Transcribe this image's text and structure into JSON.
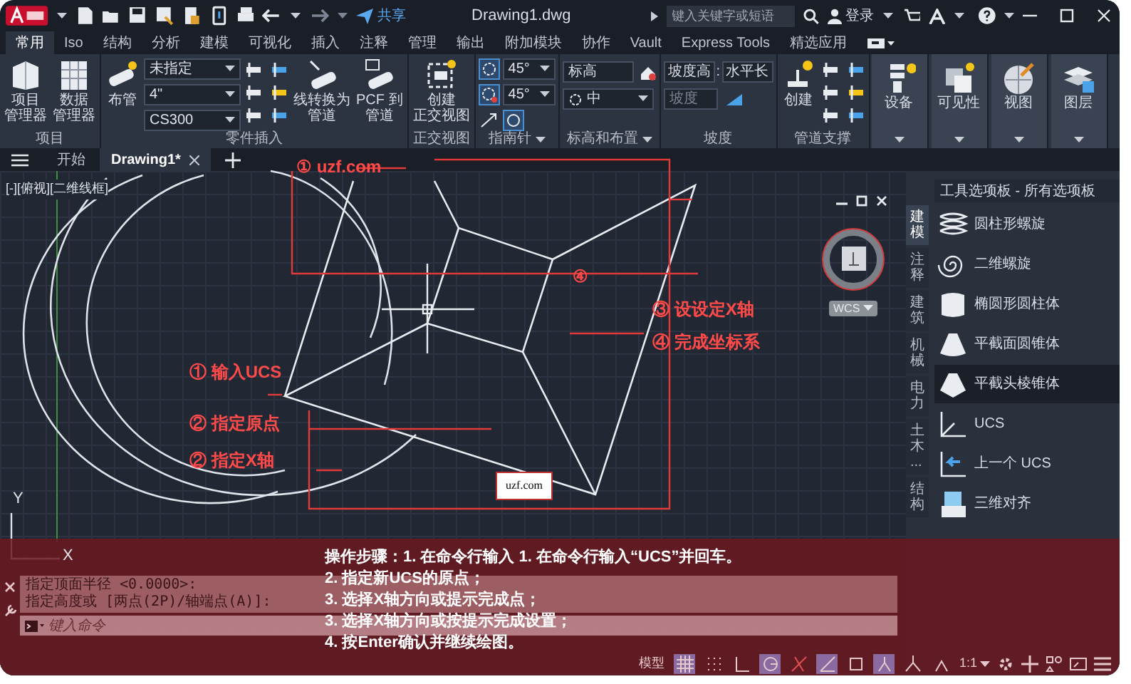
{
  "title_bar": {
    "share": "共享",
    "title": "Drawing1.dwg",
    "search": {
      "placeholder": "键入关键字或短语"
    },
    "login": "登录"
  },
  "ribbon_tabs": [
    {
      "label": "常用",
      "selected": true
    },
    {
      "label": "Iso",
      "selected": false
    },
    {
      "label": "结构",
      "selected": false
    },
    {
      "label": "分析",
      "selected": false
    },
    {
      "label": "建模",
      "selected": false
    },
    {
      "label": "可视化",
      "selected": false
    },
    {
      "label": "插入",
      "selected": false
    },
    {
      "label": "注释",
      "selected": false
    },
    {
      "label": "管理",
      "selected": false
    },
    {
      "label": "输出",
      "selected": false
    },
    {
      "label": "附加模块",
      "selected": false
    },
    {
      "label": "协作",
      "selected": false
    },
    {
      "label": "Vault",
      "selected": false
    },
    {
      "label": "Express Tools",
      "selected": false
    },
    {
      "label": "精选应用",
      "selected": false
    }
  ],
  "ribbon_panels": [
    {
      "title": "项目",
      "has_menu": false,
      "controls": [
        {
          "kind": "large",
          "lines": [
            "项目",
            "管理器"
          ]
        },
        {
          "kind": "large",
          "lines": [
            "数据",
            "管理器"
          ]
        }
      ]
    },
    {
      "title": "零件插入",
      "has_menu": false,
      "controls": [
        {
          "kind": "large",
          "lines": [
            "布管"
          ]
        },
        {
          "kind": "dropdowns",
          "values": [
            "未指定",
            "4\"",
            "CS300"
          ]
        },
        {
          "kind": "small_grid"
        },
        {
          "kind": "large",
          "lines": [
            "线转换为",
            "管道"
          ]
        },
        {
          "kind": "large",
          "lines": [
            "PCF 到",
            "管道"
          ]
        }
      ]
    },
    {
      "title": "正交视图",
      "has_menu": false,
      "controls": [
        {
          "kind": "large",
          "lines": [
            "创建",
            "正交视图"
          ]
        }
      ]
    },
    {
      "title": "指南针",
      "has_menu": true,
      "controls": [
        {
          "kind": "compass_set",
          "values": [
            "45°",
            "45°"
          ]
        }
      ]
    },
    {
      "title": "标高和布置",
      "has_menu": true,
      "controls": [
        {
          "kind": "elevation",
          "field": "标高",
          "dropdown": "中"
        }
      ]
    },
    {
      "title": "坡度",
      "has_menu": false,
      "controls": [
        {
          "kind": "slope",
          "values": [
            "坡度高",
            "水平长"
          ],
          "separator": ":",
          "placeholder": "坡度"
        }
      ]
    },
    {
      "title": "管道支撑",
      "has_menu": false,
      "controls": [
        {
          "kind": "large",
          "lines": [
            "创建"
          ]
        },
        {
          "kind": "small_grid"
        }
      ]
    },
    {
      "controls": [
        {
          "kind": "tall",
          "label": "设备"
        }
      ]
    },
    {
      "controls": [
        {
          "kind": "tall",
          "label": "可见性"
        }
      ]
    },
    {
      "controls": [
        {
          "kind": "tall",
          "label": "视图"
        }
      ]
    },
    {
      "controls": [
        {
          "kind": "tall",
          "label": "图层"
        }
      ]
    }
  ],
  "document_tabs": [
    {
      "label": "开始",
      "selected": false,
      "closable": false
    },
    {
      "label": "Drawing1*",
      "selected": true,
      "closable": true
    }
  ],
  "canvas": {
    "viewport_label": "[-][俯视][二维线框]",
    "coordinate_system": "WCS",
    "ucs_icon": {
      "x_label": "X",
      "y_label": "Y"
    },
    "annotations": [
      {
        "kind": "label",
        "text": "① uzf.com"
      },
      {
        "kind": "label",
        "text": "① 输入UCS"
      },
      {
        "kind": "label",
        "text": "② 指定原点"
      },
      {
        "kind": "label",
        "text": "② 指定X轴"
      },
      {
        "kind": "marker",
        "text": "④"
      },
      {
        "kind": "label",
        "text": "③ 设设定X轴"
      },
      {
        "kind": "label",
        "text": "④ 完成坐标系"
      },
      {
        "kind": "stamp",
        "text": "uzf.com"
      }
    ]
  },
  "tool_palette": {
    "title": "工具选项板 - 所有选项板",
    "tabs": [
      {
        "label": "建模",
        "selected": true
      },
      {
        "label": "注释",
        "selected": false
      },
      {
        "label": "建筑",
        "selected": false
      },
      {
        "label": "机械",
        "selected": false
      },
      {
        "label": "电力",
        "selected": false
      },
      {
        "label": "土木...",
        "selected": false
      },
      {
        "label": "结构",
        "selected": false
      }
    ],
    "items": [
      {
        "label": "圆柱形螺旋",
        "selected": false
      },
      {
        "label": "二维螺旋",
        "selected": false
      },
      {
        "label": "椭圆形圆柱体",
        "selected": false
      },
      {
        "label": "平截面圆锥体",
        "selected": false
      },
      {
        "label": "平截头棱锥体",
        "selected": true
      },
      {
        "label": "UCS",
        "selected": false
      },
      {
        "label": "上一个 UCS",
        "selected": false
      },
      {
        "label": "三维对齐",
        "selected": false
      }
    ]
  },
  "command_line": {
    "history": [
      "指定顶面半径 <0.0000>:",
      "指定高度或 [两点(2P)/轴端点(A)]:"
    ],
    "input": {
      "placeholder": "键入命令"
    }
  },
  "instructions": [
    "操作步骤：1. 在命令行输入  1. 在命令行输入“UCS”并回车。",
    "2. 指定新UCS的原点；",
    "3. 选择X轴方向或提示完成点；",
    "3. 选择X轴方向或按提示完成设置；",
    "4. 按Enter确认并继续绘图。"
  ],
  "status_bar": {
    "model": "模型",
    "scale": "1:1",
    "toggles": [
      {
        "on": true
      },
      {
        "on": false
      },
      {
        "on": false
      },
      {
        "on": true
      },
      {
        "on": false
      },
      {
        "on": true
      },
      {
        "on": false
      },
      {
        "on": true
      },
      {
        "on": false
      },
      {
        "on": false
      }
    ]
  }
}
